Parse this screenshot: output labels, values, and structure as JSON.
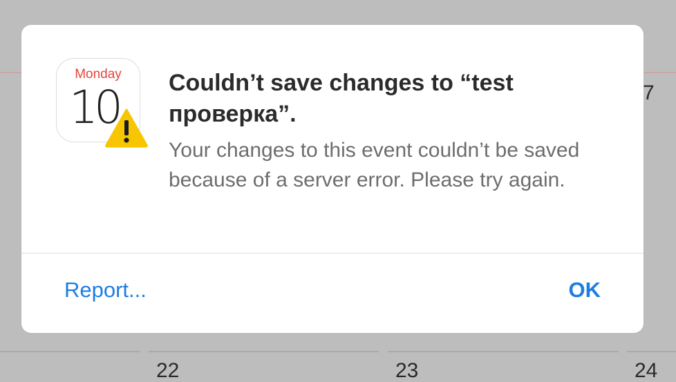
{
  "background": {
    "dates": [
      "7",
      "22",
      "23",
      "24"
    ]
  },
  "app_icon": {
    "weekday": "Monday",
    "day": "10",
    "badge": "warning-icon"
  },
  "alert": {
    "title": "Couldn’t save changes to “test проверка”.",
    "message": "Your changes to this event couldn’t be saved because of a server error. Please try again.",
    "buttons": {
      "report": "Report...",
      "ok": "OK"
    }
  },
  "colors": {
    "link": "#1e7de0",
    "weekday": "#e8433a",
    "warning": "#f7c600"
  }
}
